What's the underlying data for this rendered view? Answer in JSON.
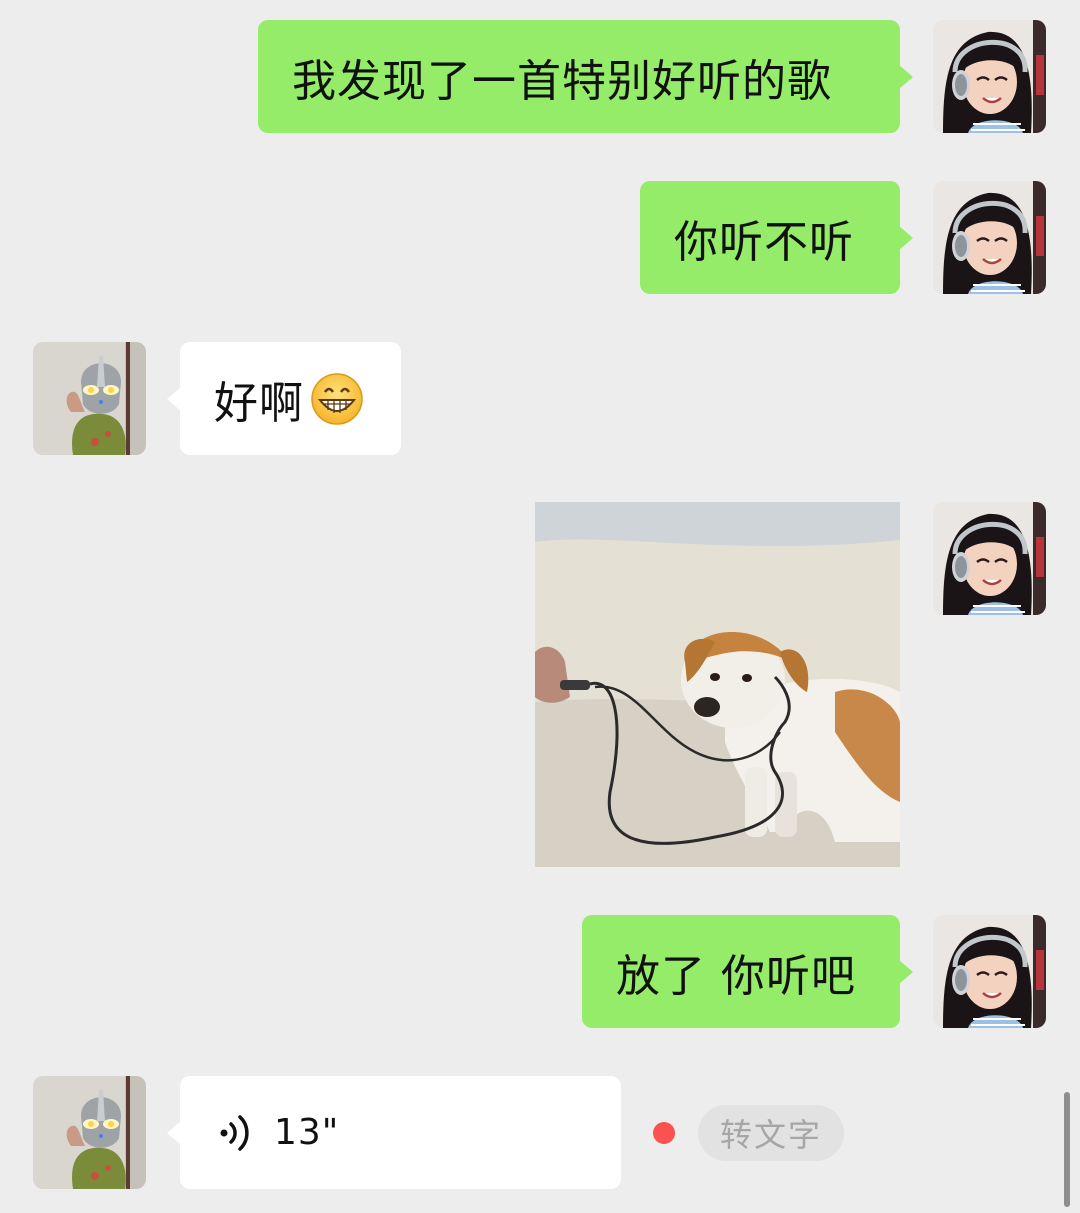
{
  "messages": [
    {
      "sender": "self",
      "kind": "text",
      "text": "我发现了一首特别好听的歌"
    },
    {
      "sender": "self",
      "kind": "text",
      "text": "你听不听"
    },
    {
      "sender": "other",
      "kind": "text",
      "text": "好啊",
      "emoji": "grinning-face-emoji"
    },
    {
      "sender": "self",
      "kind": "image",
      "image": "dog-with-earphones-sticker"
    },
    {
      "sender": "self",
      "kind": "text",
      "text": "放了 你听吧"
    },
    {
      "sender": "other",
      "kind": "voice",
      "duration": "13\"",
      "icon": "voice-wave-icon",
      "unread": true,
      "transcribe_label": "转文字"
    }
  ],
  "avatars": {
    "self": "girl-with-headphones-avatar",
    "other": "ultraman-avatar"
  },
  "colors": {
    "background": "#ededed",
    "self_bubble": "#95ec69",
    "other_bubble": "#ffffff",
    "unread_dot": "#fa5151"
  }
}
